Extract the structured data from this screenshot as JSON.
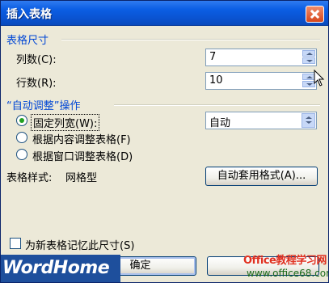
{
  "title": "插入表格",
  "table_size": {
    "heading": "表格尺寸",
    "columns_label": "列数(C):",
    "columns_value": "7",
    "rows_label": "行数(R):",
    "rows_value": "10"
  },
  "autofit": {
    "heading": "“自动调整”操作",
    "options": [
      {
        "label": "固定列宽(W):",
        "selected": true
      },
      {
        "label": "根据内容调整表格(F)",
        "selected": false
      },
      {
        "label": "根据窗口调整表格(D)",
        "selected": false
      }
    ],
    "width_value": "自动"
  },
  "style": {
    "label": "表格样式:",
    "value": "网格型",
    "autoformat_button": "自动套用格式(A)..."
  },
  "remember_label": "为新表格记忆此尺寸(S)",
  "ok_button": "确定",
  "watermark": {
    "left": "WordHome",
    "right_title": "Office教程学习网",
    "right_url": "www.office68.com"
  },
  "colors": {
    "accent": "#0046d5",
    "title_bar": "#0a54d2"
  }
}
